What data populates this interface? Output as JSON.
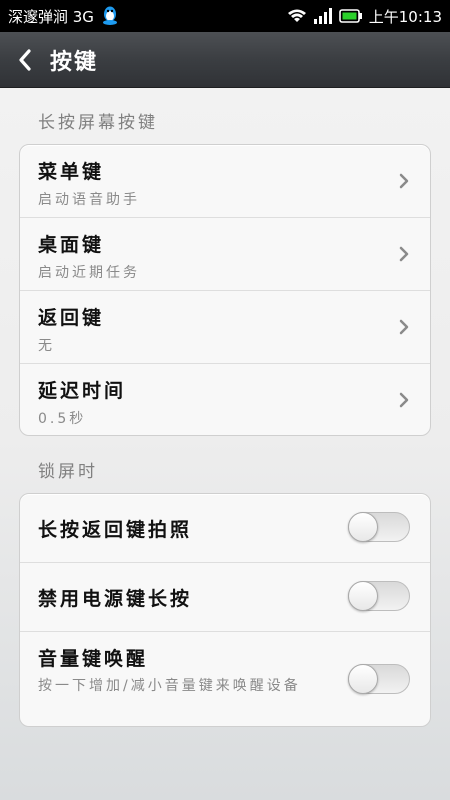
{
  "status_bar": {
    "carrier": "深邃弹涧 3G",
    "time": "上午10:13",
    "icons": [
      "qq-icon",
      "wifi-icon",
      "signal-icon",
      "battery-icon"
    ]
  },
  "header": {
    "back_icon": "chevron-left-icon",
    "title": "按键"
  },
  "section1": {
    "label": "长按屏幕按键",
    "items": [
      {
        "title": "菜单键",
        "subtitle": "启动语音助手"
      },
      {
        "title": "桌面键",
        "subtitle": "启动近期任务"
      },
      {
        "title": "返回键",
        "subtitle": "无"
      },
      {
        "title": "延迟时间",
        "subtitle": "0.5秒"
      }
    ]
  },
  "section2": {
    "label": "锁屏时",
    "items": [
      {
        "title": "长按返回键拍照",
        "on": false
      },
      {
        "title": "禁用电源键长按",
        "on": false
      },
      {
        "title": "音量键唤醒",
        "subtitle": "按一下增加/减小音量键来唤醒设备",
        "on": false
      }
    ]
  },
  "colors": {
    "title_bar": "#3b3e42",
    "card_bg": "#f8f8f8",
    "secondary_text": "#8a8a8a"
  }
}
